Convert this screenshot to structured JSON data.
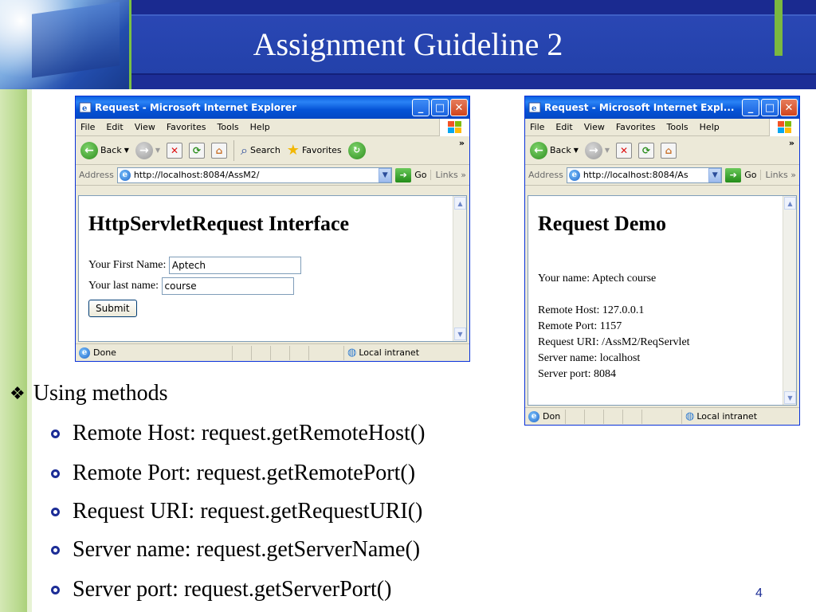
{
  "slide": {
    "title": "Assignment Guideline 2",
    "page_number": "4"
  },
  "colors": {
    "title_bar": "#1c2d96",
    "accent_green": "#7bb840",
    "bullet_accent": "#1c2d96"
  },
  "left_browser": {
    "window_title": "Request - Microsoft Internet Explorer",
    "menu": [
      "File",
      "Edit",
      "View",
      "Favorites",
      "Tools",
      "Help"
    ],
    "toolbar": {
      "back": "Back",
      "search": "Search",
      "favorites": "Favorites",
      "more": "»"
    },
    "address_label": "Address",
    "address_value": "http://localhost:8084/AssM2/",
    "go_label": "Go",
    "links_label": "Links",
    "heading": "HttpServletRequest Interface",
    "first_name_label": "Your First Name:",
    "first_name_value": "Aptech",
    "last_name_label": "Your last name:",
    "last_name_value": "course",
    "submit_label": "Submit",
    "status_text": "Done",
    "zone_text": "Local intranet"
  },
  "right_browser": {
    "window_title": "Request - Microsoft Internet Expl...",
    "menu": [
      "File",
      "Edit",
      "View",
      "Favorites",
      "Tools",
      "Help"
    ],
    "toolbar": {
      "back": "Back",
      "more": "»"
    },
    "address_label": "Address",
    "address_value": "http://localhost:8084/As",
    "go_label": "Go",
    "links_label": "Links",
    "heading": "Request Demo",
    "lines": [
      "Your name: Aptech course",
      "Remote Host: 127.0.0.1",
      "Remote Port: 1157",
      "Request URI: /AssM2/ReqServlet",
      "Server name: localhost",
      "Server port: 8084"
    ],
    "status_text": "Don",
    "zone_text": "Local intranet"
  },
  "bullets": {
    "main": "Using methods",
    "items": [
      "Remote Host: request.getRemoteHost()",
      "Remote Port: request.getRemotePort()",
      "Request URI: request.getRequestURI()",
      "Server name: request.getServerName()",
      "Server port: request.getServerPort()"
    ]
  }
}
